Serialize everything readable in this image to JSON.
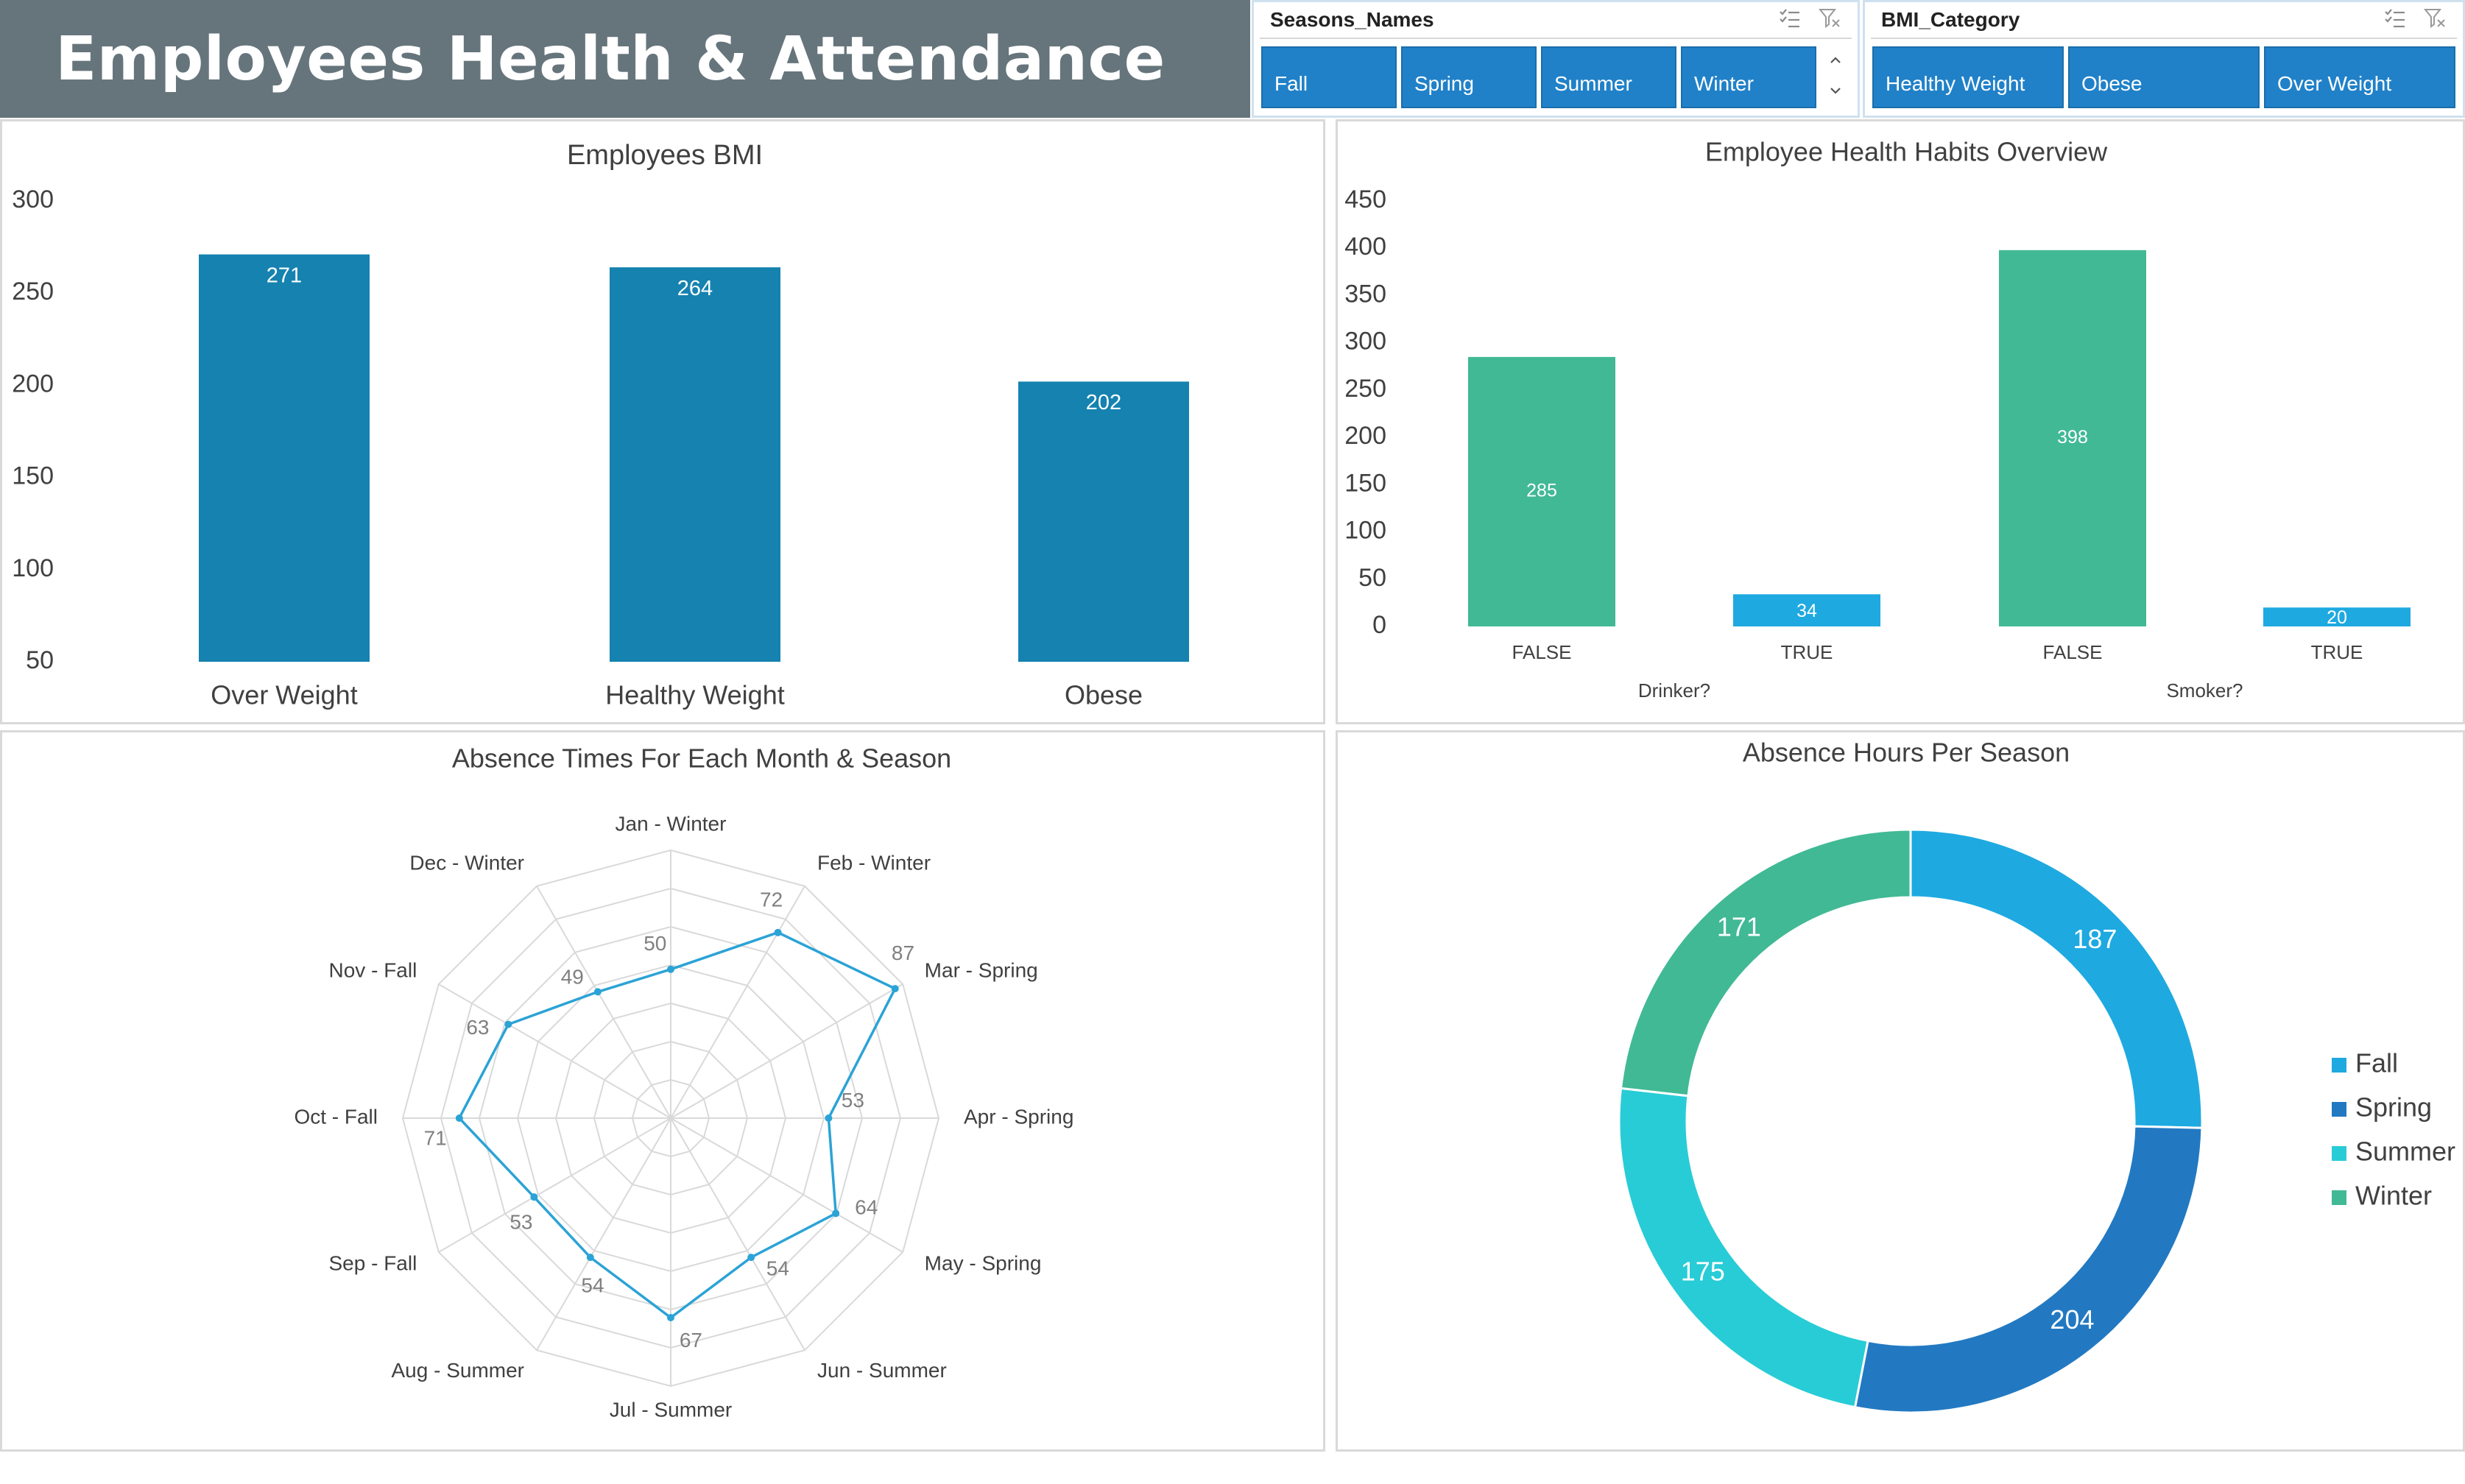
{
  "title": "Employees Health & Attendance",
  "slicers": {
    "seasons": {
      "title": "Seasons_Names",
      "items": [
        "Fall",
        "Spring",
        "Summer",
        "Winter"
      ]
    },
    "bmi": {
      "title": "BMI_Category",
      "items": [
        "Healthy Weight",
        "Obese",
        "Over Weight"
      ]
    },
    "icons": [
      "multi-select-icon",
      "clear-filter-icon"
    ],
    "button_color": "#2081c8"
  },
  "chart_data": [
    {
      "id": "bmi",
      "type": "bar",
      "title": "Employees BMI",
      "categories": [
        "Over Weight",
        "Healthy Weight",
        "Obese"
      ],
      "values": [
        271,
        264,
        202
      ],
      "ylim": [
        50,
        300
      ],
      "yticks": [
        50,
        100,
        150,
        200,
        250,
        300
      ],
      "color": "#1582b0",
      "grid": false,
      "data_labels": true
    },
    {
      "id": "habits",
      "type": "bar",
      "title": "Employee Health Habits Overview",
      "groups": [
        {
          "name": "Drinker?",
          "categories": [
            "FALSE",
            "TRUE"
          ],
          "values": [
            285,
            34
          ]
        },
        {
          "name": "Smoker?",
          "categories": [
            "FALSE",
            "TRUE"
          ],
          "values": [
            398,
            20
          ]
        }
      ],
      "colors": {
        "FALSE": "#41b995",
        "TRUE": "#1ea9e1"
      },
      "ylim": [
        0,
        450
      ],
      "yticks": [
        0,
        50,
        100,
        150,
        200,
        250,
        300,
        350,
        400,
        450
      ],
      "grid": false,
      "data_labels": true
    },
    {
      "id": "absence_radar",
      "type": "radar",
      "title": "Absence Times For Each Month & Season",
      "categories": [
        "Jan -  Winter",
        "Feb -  Winter",
        "Mar - Spring",
        "Apr -  Spring",
        "May - Spring",
        "Jun - Summer",
        "Jul -  Summer",
        "Aug -  Summer",
        "Sep -  Fall",
        "Oct -  Fall",
        "Nov -  Fall",
        "Dec -  Winter"
      ],
      "values": [
        50,
        72,
        87,
        53,
        64,
        54,
        67,
        54,
        53,
        71,
        63,
        49
      ],
      "rmax": 90,
      "rings": 7,
      "color": "#2ba3d6"
    },
    {
      "id": "absence_hours",
      "type": "pie",
      "donut": true,
      "title": "Absence Hours Per Season",
      "labels": [
        "Fall",
        "Spring",
        "Summer",
        "Winter"
      ],
      "values": [
        187,
        204,
        175,
        171
      ],
      "colors": [
        "#1ea9e1",
        "#2279c2",
        "#28ccd6",
        "#41b995"
      ],
      "legend": "right"
    }
  ]
}
